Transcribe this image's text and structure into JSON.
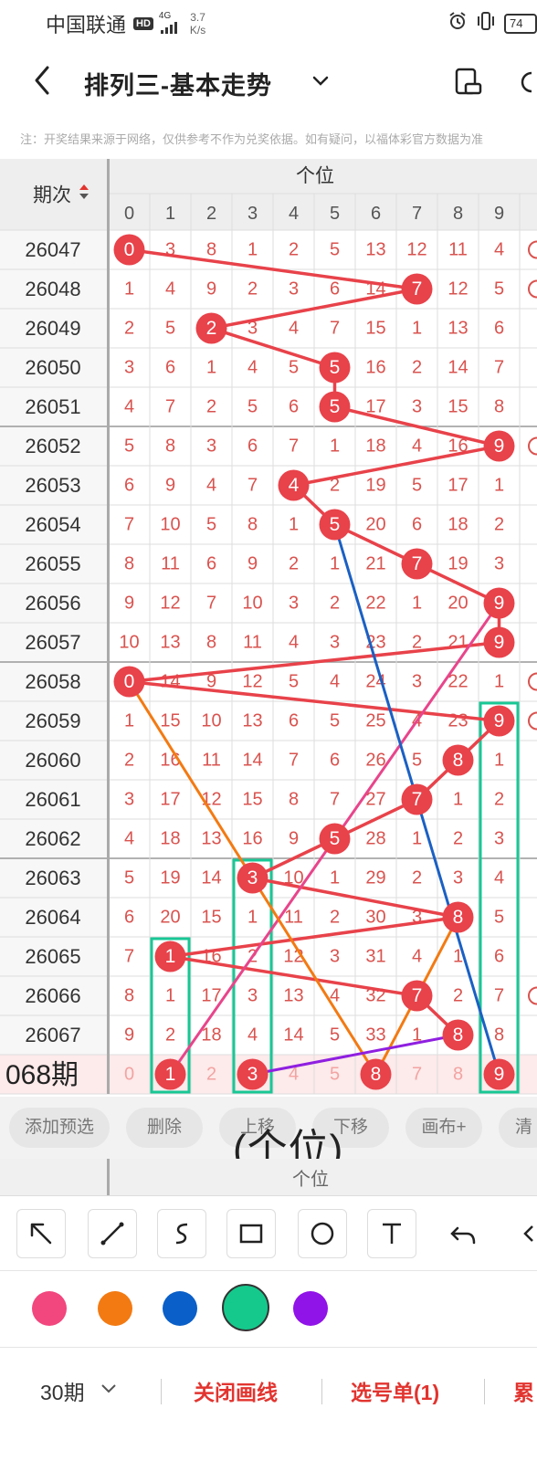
{
  "status_bar": {
    "carrier": "中国联通",
    "hd": "HD",
    "network": "4G",
    "speed_value": "3.7",
    "speed_unit": "K/s",
    "battery": "74"
  },
  "nav": {
    "title": "排列三-基本走势"
  },
  "notice": "注：开奖结果来源于网络，仅供参考不作为兑奖依据。如有疑问，以福体彩官方数据为准",
  "table": {
    "period_header": "期次",
    "position_header": "个位",
    "digits": [
      "0",
      "1",
      "2",
      "3",
      "4",
      "5",
      "6",
      "7",
      "8",
      "9"
    ],
    "rows": [
      {
        "period": "26047",
        "cells": [
          "0",
          "3",
          "8",
          "1",
          "2",
          "5",
          "13",
          "12",
          "11",
          "4"
        ],
        "winner": 0
      },
      {
        "period": "26048",
        "cells": [
          "1",
          "4",
          "9",
          "2",
          "3",
          "6",
          "14",
          "7",
          "12",
          "5"
        ],
        "winner": 7
      },
      {
        "period": "26049",
        "cells": [
          "2",
          "5",
          "2",
          "3",
          "4",
          "7",
          "15",
          "1",
          "13",
          "6"
        ],
        "winner": 2
      },
      {
        "period": "26050",
        "cells": [
          "3",
          "6",
          "1",
          "4",
          "5",
          "5",
          "16",
          "2",
          "14",
          "7"
        ],
        "winner": 5
      },
      {
        "period": "26051",
        "cells": [
          "4",
          "7",
          "2",
          "5",
          "6",
          "5",
          "17",
          "3",
          "15",
          "8"
        ],
        "winner": 5
      },
      {
        "period": "26052",
        "cells": [
          "5",
          "8",
          "3",
          "6",
          "7",
          "1",
          "18",
          "4",
          "16",
          "9"
        ],
        "winner": 9
      },
      {
        "period": "26053",
        "cells": [
          "6",
          "9",
          "4",
          "7",
          "4",
          "2",
          "19",
          "5",
          "17",
          "1"
        ],
        "winner": 4
      },
      {
        "period": "26054",
        "cells": [
          "7",
          "10",
          "5",
          "8",
          "1",
          "5",
          "20",
          "6",
          "18",
          "2"
        ],
        "winner": 5
      },
      {
        "period": "26055",
        "cells": [
          "8",
          "11",
          "6",
          "9",
          "2",
          "1",
          "21",
          "7",
          "19",
          "3"
        ],
        "winner": 7
      },
      {
        "period": "26056",
        "cells": [
          "9",
          "12",
          "7",
          "10",
          "3",
          "2",
          "22",
          "1",
          "20",
          "9"
        ],
        "winner": 9
      },
      {
        "period": "26057",
        "cells": [
          "10",
          "13",
          "8",
          "11",
          "4",
          "3",
          "23",
          "2",
          "21",
          "9"
        ],
        "winner": 9
      },
      {
        "period": "26058",
        "cells": [
          "0",
          "14",
          "9",
          "12",
          "5",
          "4",
          "24",
          "3",
          "22",
          "1"
        ],
        "winner": 0
      },
      {
        "period": "26059",
        "cells": [
          "1",
          "15",
          "10",
          "13",
          "6",
          "5",
          "25",
          "4",
          "23",
          "9"
        ],
        "winner": 9
      },
      {
        "period": "26060",
        "cells": [
          "2",
          "16",
          "11",
          "14",
          "7",
          "6",
          "26",
          "5",
          "8",
          "1"
        ],
        "winner": 8
      },
      {
        "period": "26061",
        "cells": [
          "3",
          "17",
          "12",
          "15",
          "8",
          "7",
          "27",
          "7",
          "1",
          "2"
        ],
        "winner": 7
      },
      {
        "period": "26062",
        "cells": [
          "4",
          "18",
          "13",
          "16",
          "9",
          "5",
          "28",
          "1",
          "2",
          "3"
        ],
        "winner": 5
      },
      {
        "period": "26063",
        "cells": [
          "5",
          "19",
          "14",
          "3",
          "10",
          "1",
          "29",
          "2",
          "3",
          "4"
        ],
        "winner": 3
      },
      {
        "period": "26064",
        "cells": [
          "6",
          "20",
          "15",
          "1",
          "11",
          "2",
          "30",
          "3",
          "8",
          "5"
        ],
        "winner": 8
      },
      {
        "period": "26065",
        "cells": [
          "7",
          "1",
          "16",
          "2",
          "12",
          "3",
          "31",
          "4",
          "1",
          "6"
        ],
        "winner": 1
      },
      {
        "period": "26066",
        "cells": [
          "8",
          "1",
          "17",
          "3",
          "13",
          "4",
          "32",
          "7",
          "2",
          "7"
        ],
        "winner": 7
      },
      {
        "period": "26067",
        "cells": [
          "9",
          "2",
          "18",
          "4",
          "14",
          "5",
          "33",
          "1",
          "8",
          "8"
        ],
        "winner": 8
      }
    ],
    "preview_row": {
      "label": "068期",
      "cells": [
        "0",
        "1",
        "2",
        "3",
        "4",
        "5",
        "8",
        "7",
        "8",
        "9"
      ],
      "selected": [
        1,
        3,
        6,
        9
      ]
    },
    "colors": {
      "ball": "#e8424a",
      "number": "#d9534f",
      "pink_line": "#e8458b",
      "orange_line": "#f37a12",
      "blue_line": "#1a60c4",
      "teal_box": "#18c795",
      "purple_line": "#8f1fe0"
    }
  },
  "actions": {
    "add": "添加预选",
    "delete": "删除",
    "move_up": "上移",
    "move_down": "下移",
    "canvas": "画布+",
    "clear": "清"
  },
  "overlay_caption": "(个位)",
  "footer_header": "个位",
  "tools": [
    "arrow-tool-icon",
    "line-tool-icon",
    "curve-tool-icon",
    "rectangle-tool-icon",
    "circle-tool-icon",
    "text-tool-icon",
    "undo-icon",
    "eraser-icon"
  ],
  "palette": [
    "#f2467e",
    "#f37a12",
    "#0a5fc8",
    "#15c98d",
    "#9013e8"
  ],
  "bottom": {
    "period": "30期",
    "close_draw": "关闭画线",
    "ticket": "选号单(1)"
  }
}
